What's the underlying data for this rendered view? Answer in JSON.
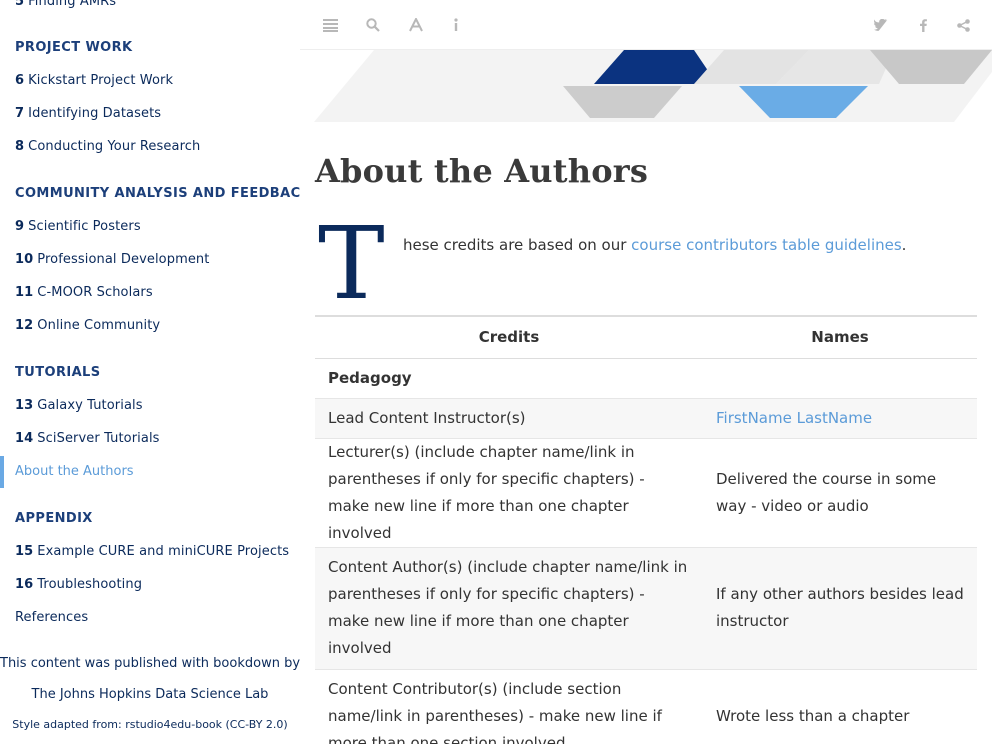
{
  "sidebar": {
    "partial_item": {
      "num": "5",
      "label": "Finding AMRs"
    },
    "sections": [
      {
        "heading": "PROJECT WORK"
      },
      {
        "heading": "COMMUNITY ANALYSIS AND FEEDBACK"
      },
      {
        "heading": "TUTORIALS"
      },
      {
        "heading": "APPENDIX"
      }
    ],
    "items": [
      {
        "num": "6",
        "label": "Kickstart Project Work"
      },
      {
        "num": "7",
        "label": "Identifying Datasets"
      },
      {
        "num": "8",
        "label": "Conducting Your Research"
      },
      {
        "num": "9",
        "label": "Scientific Posters"
      },
      {
        "num": "10",
        "label": "Professional Development"
      },
      {
        "num": "11",
        "label": "C-MOOR Scholars"
      },
      {
        "num": "12",
        "label": "Online Community"
      },
      {
        "num": "13",
        "label": "Galaxy Tutorials"
      },
      {
        "num": "14",
        "label": "SciServer Tutorials"
      },
      {
        "num": "15",
        "label": "Example CURE and miniCURE Projects"
      },
      {
        "num": "16",
        "label": "Troubleshooting"
      }
    ],
    "active_item": "About the Authors",
    "references": "References",
    "footer": {
      "published": "This content was published with bookdown by:",
      "org": "The Johns Hopkins Data Science Lab",
      "style": "Style adapted from: rstudio4edu-book (CC-BY 2.0)"
    }
  },
  "toolbar": {
    "left_icons": [
      "menu-icon",
      "search-icon",
      "font-icon",
      "info-icon"
    ],
    "right_icons": [
      "twitter-icon",
      "facebook-icon",
      "share-icon"
    ]
  },
  "colors": {
    "navy": "#0b2a5b",
    "accent_blue": "#5b9bd8",
    "banner_navy": "#0b3380",
    "banner_light": "#6aace6",
    "banner_gray": "#cccccc"
  },
  "main": {
    "title": "About the Authors",
    "dropcap": "T",
    "intro_text": "hese credits are based on our ",
    "intro_link": "course contributors table guidelines",
    "intro_end": ".",
    "table": {
      "headers": [
        "Credits",
        "Names"
      ],
      "rows": [
        {
          "credit": "Pedagogy",
          "name": "",
          "bold": true
        },
        {
          "credit": "Lead Content Instructor(s)",
          "name": "FirstName LastName",
          "link": true
        },
        {
          "credit": "Lecturer(s) (include chapter name/link in parentheses if only for specific chapters) - make new line if more than one chapter involved",
          "name": "Delivered the course in some way - video or audio"
        },
        {
          "credit": "Content Author(s) (include chapter name/link in parentheses if only for specific chapters) - make new line if more than one chapter involved",
          "name": "If any other authors besides lead instructor"
        },
        {
          "credit": "Content Contributor(s) (include section name/link in parentheses) - make new line if more than one section involved",
          "name": "Wrote less than a chapter"
        }
      ]
    }
  }
}
